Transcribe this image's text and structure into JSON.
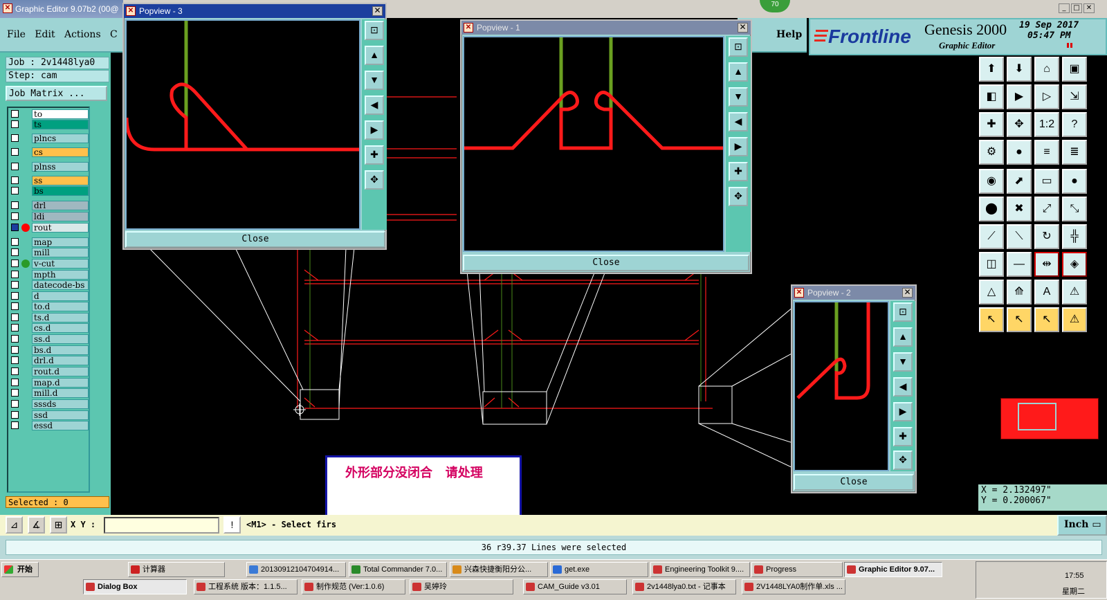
{
  "title_bar": {
    "title": "Graphic Editor 9.07b2 (00@",
    "badge": "70"
  },
  "menu": {
    "file": "File",
    "edit": "Edit",
    "actions": "Actions",
    "c": "C",
    "help": "Help"
  },
  "logo": {
    "brand": "Frontline",
    "product": "Genesis 2000",
    "subtitle": "Graphic Editor",
    "date": "19 Sep 2017",
    "time": "05:47 PM"
  },
  "job": {
    "job_line": "Job : 2v1448lya0",
    "step_line": "Step: cam",
    "matrix_btn": "Job Matrix ..."
  },
  "layers": [
    {
      "name": "to",
      "color": "#ffffff",
      "dot": ""
    },
    {
      "name": "ts",
      "color": "#00a080",
      "dot": ""
    },
    {
      "name": "plncs",
      "color": "#9ed4d4",
      "dot": ""
    },
    {
      "name": "cs",
      "color": "#ffc04c",
      "dot": ""
    },
    {
      "name": "plnss",
      "color": "#9ed4d4",
      "dot": ""
    },
    {
      "name": "ss",
      "color": "#ffc04c",
      "dot": ""
    },
    {
      "name": "bs",
      "color": "#00a080",
      "dot": ""
    },
    {
      "name": "drl",
      "color": "#a0b8c0",
      "dot": ""
    },
    {
      "name": "ldi",
      "color": "#a0b8c0",
      "dot": ""
    },
    {
      "name": "rout",
      "color": "#d8e8e8",
      "dot": "#ff0000"
    },
    {
      "name": "map",
      "color": "#9ed4d4",
      "dot": ""
    },
    {
      "name": "mill",
      "color": "#9ed4d4",
      "dot": ""
    },
    {
      "name": "v-cut",
      "color": "#9ed4d4",
      "dot": "#2a9a2a"
    },
    {
      "name": "mpth",
      "color": "#9ed4d4",
      "dot": ""
    },
    {
      "name": "datecode-bs",
      "color": "#9ed4d4",
      "dot": ""
    },
    {
      "name": "d",
      "color": "#9ed4d4",
      "dot": ""
    },
    {
      "name": "to.d",
      "color": "#9ed4d4",
      "dot": ""
    },
    {
      "name": "ts.d",
      "color": "#9ed4d4",
      "dot": ""
    },
    {
      "name": "cs.d",
      "color": "#9ed4d4",
      "dot": ""
    },
    {
      "name": "ss.d",
      "color": "#9ed4d4",
      "dot": ""
    },
    {
      "name": "bs.d",
      "color": "#9ed4d4",
      "dot": ""
    },
    {
      "name": "drl.d",
      "color": "#9ed4d4",
      "dot": ""
    },
    {
      "name": "rout.d",
      "color": "#9ed4d4",
      "dot": ""
    },
    {
      "name": "map.d",
      "color": "#9ed4d4",
      "dot": ""
    },
    {
      "name": "mill.d",
      "color": "#9ed4d4",
      "dot": ""
    },
    {
      "name": "sssds",
      "color": "#9ed4d4",
      "dot": ""
    },
    {
      "name": "ssd",
      "color": "#9ed4d4",
      "dot": ""
    },
    {
      "name": "essd",
      "color": "#9ed4d4",
      "dot": ""
    }
  ],
  "selected_text": "Selected : 0",
  "popups": {
    "p3": {
      "title": "Popview - 3",
      "close": "Close"
    },
    "p1": {
      "title": "Popview - 1",
      "close": "Close"
    },
    "p2": {
      "title": "Popview - 2",
      "close": "Close"
    }
  },
  "coords": {
    "x": "X = 2.132497\"",
    "y": "Y = 0.200067\""
  },
  "bottom": {
    "xy_label": "X Y :",
    "prompt": "<M1> - Select firs",
    "units": "Inch"
  },
  "status": "36 r39.37 Lines were selected",
  "message": "外形部分没闭合   请处理",
  "taskbar": {
    "start": "开始",
    "row1": [
      "计算器",
      "20130912104704914...",
      "Total Commander 7.0...",
      "兴森快捷衡阳分公...",
      "get.exe",
      "Engineering Toolkit 9....",
      "Progress",
      "Graphic Editor 9.07..."
    ],
    "row2": [
      "Dialog Box",
      "工程系统 版本：1.1.5...",
      "制作规范 (Ver:1.0.6)",
      "吴婷玲",
      "CAM_Guide v3.01",
      "2v1448lya0.txt - 记事本",
      "2V1448LYA0制作单.xls ..."
    ],
    "clock": "17:55",
    "weekday": "星期二"
  },
  "colors": {
    "teal": "#9ed4d4",
    "panel": "#5cc6b0",
    "trace": "#ff1a1a",
    "vcut": "#6aa020"
  }
}
